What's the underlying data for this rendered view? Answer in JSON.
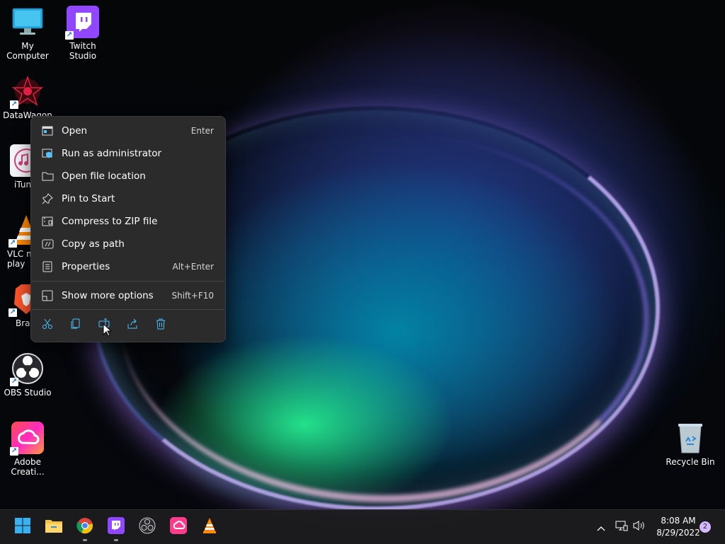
{
  "desktop": {
    "icons": [
      {
        "label": "My Computer"
      },
      {
        "label": "Twitch Studio"
      },
      {
        "label": "DataWagon"
      },
      {
        "label": "iTun"
      },
      {
        "label": "VLC m\nplay"
      },
      {
        "label": "Brav"
      },
      {
        "label": "OBS Studio"
      },
      {
        "label": "Adobe\nCreati..."
      },
      {
        "label": "Recycle Bin"
      }
    ]
  },
  "context_menu": {
    "items": [
      {
        "label": "Open",
        "shortcut": "Enter",
        "icon": "open-icon"
      },
      {
        "label": "Run as administrator",
        "shortcut": "",
        "icon": "shield-icon"
      },
      {
        "label": "Open file location",
        "shortcut": "",
        "icon": "folder-icon"
      },
      {
        "label": "Pin to Start",
        "shortcut": "",
        "icon": "pin-icon"
      },
      {
        "label": "Compress to ZIP file",
        "shortcut": "",
        "icon": "zip-icon"
      },
      {
        "label": "Copy as path",
        "shortcut": "",
        "icon": "path-icon"
      },
      {
        "label": "Properties",
        "shortcut": "Alt+Enter",
        "icon": "properties-icon"
      },
      {
        "label": "Show more options",
        "shortcut": "Shift+F10",
        "icon": "more-options-icon"
      }
    ],
    "toolbar": [
      "cut-icon",
      "copy-icon",
      "rename-icon",
      "share-icon",
      "delete-icon"
    ]
  },
  "taskbar": {
    "apps": [
      "start-icon",
      "file-explorer-icon",
      "chrome-icon",
      "twitch-icon",
      "obs-icon",
      "creative-cloud-icon",
      "vlc-icon"
    ],
    "clock": {
      "time": "8:08 AM",
      "date": "8/29/2022"
    },
    "notification_count": "2"
  },
  "colors": {
    "accent": "#4cc2ff",
    "menu_bg": "#2b2b2b",
    "taskbar_bg": "#1c1c1e"
  }
}
